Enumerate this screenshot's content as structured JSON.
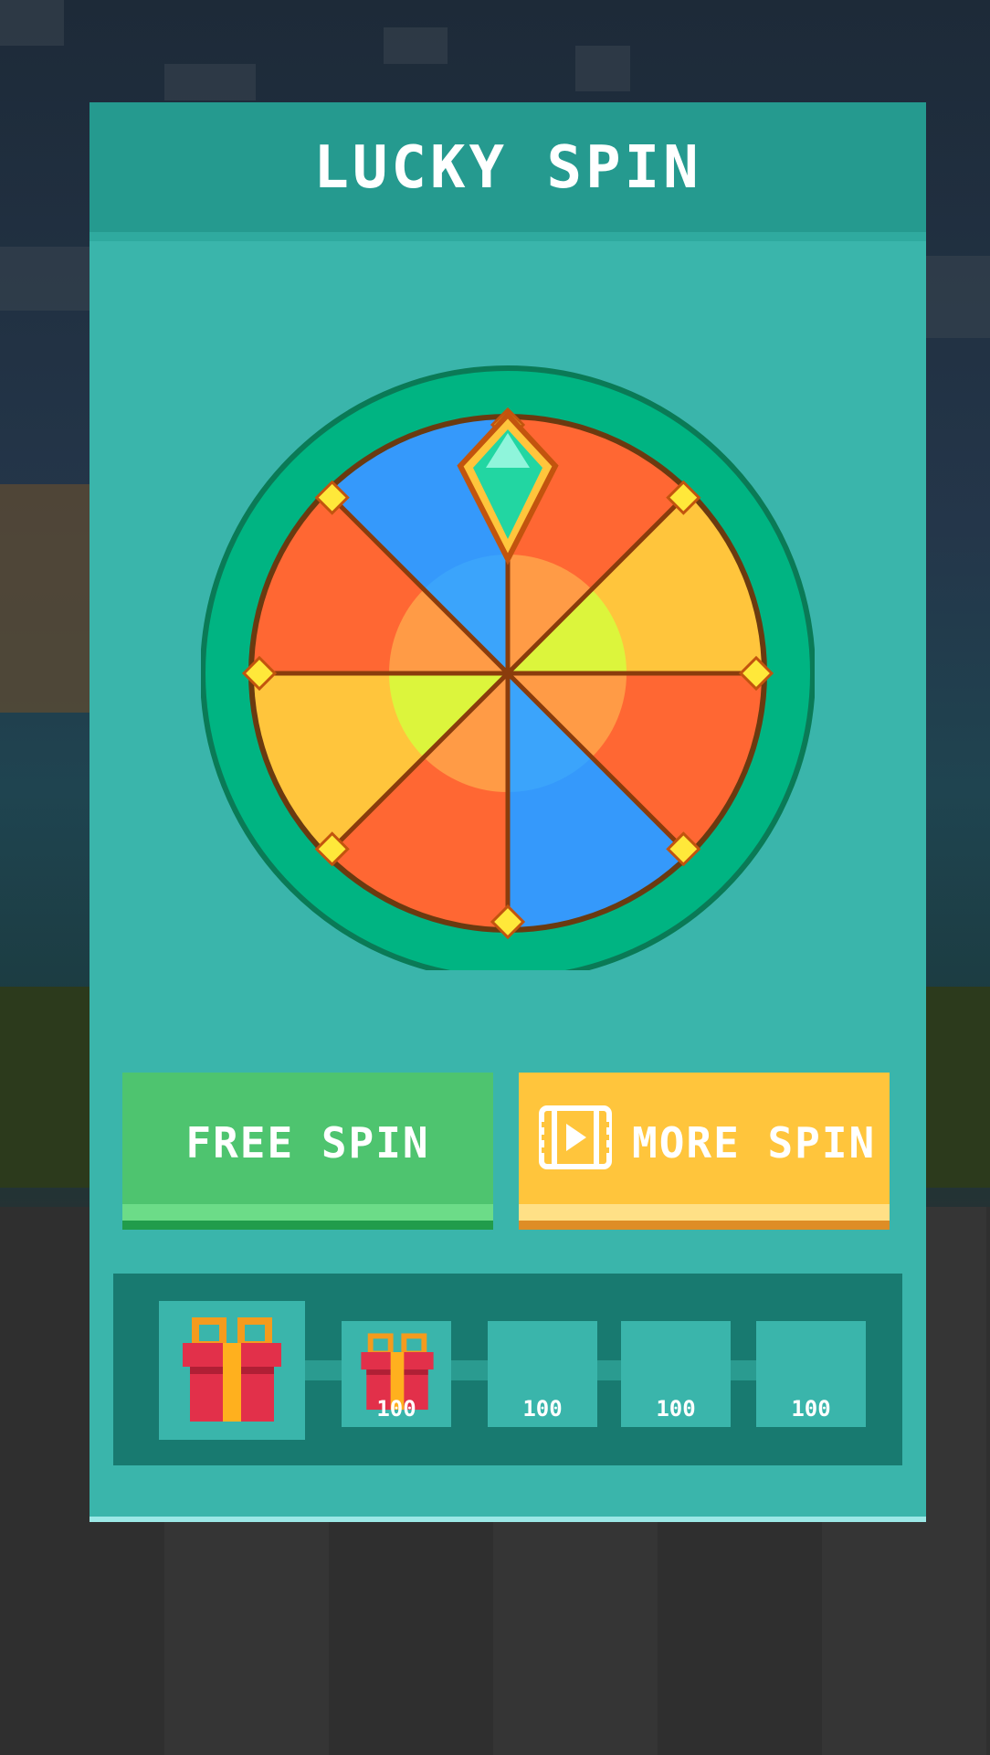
{
  "title": "LUCKY SPIN",
  "buttons": {
    "free_spin": "FREE SPIN",
    "more_spin": "MORE SPIN"
  },
  "rewards": [
    {
      "icon": "gift-icon",
      "value": ""
    },
    {
      "icon": "gift-icon",
      "value": "100"
    },
    {
      "icon": "",
      "value": "100"
    },
    {
      "icon": "",
      "value": "100"
    },
    {
      "icon": "",
      "value": "100"
    }
  ],
  "wheel": {
    "segment_colors": [
      "#ff6733",
      "#ffc53c",
      "#ff6733",
      "#3599fb",
      "#ff6733",
      "#ffc53c",
      "#ff6733",
      "#3599fb"
    ],
    "pointer_icon": "gem-pointer-icon"
  },
  "colors": {
    "panel": "#3ab5ab",
    "header": "#259a8f",
    "free_button": "#4ec46f",
    "more_button": "#ffc53c",
    "wheel_rim": "#00b482"
  }
}
